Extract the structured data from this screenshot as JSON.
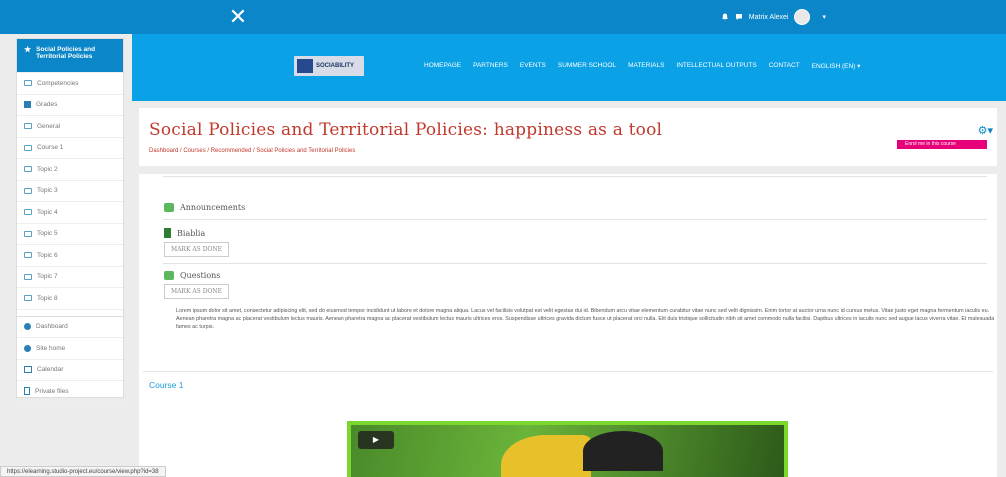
{
  "topbar": {
    "close_glyph": "✕",
    "bell_icon": "bell-icon",
    "chat_icon": "chat-icon",
    "user_name": "Matrix Alexei",
    "caret": "▾"
  },
  "sidebar": {
    "active": {
      "label": "Social Policies and Territorial Policies",
      "icon": "star-icon"
    },
    "items": [
      {
        "label": "Competencies",
        "icon": "checklist-icon"
      },
      {
        "label": "Grades",
        "icon": "table-icon"
      },
      {
        "label": "General",
        "icon": "folder-icon"
      },
      {
        "label": "Course 1",
        "icon": "folder-icon"
      },
      {
        "label": "Topic 2",
        "icon": "folder-icon"
      },
      {
        "label": "Topic 3",
        "icon": "folder-icon"
      },
      {
        "label": "Topic 4",
        "icon": "folder-icon"
      },
      {
        "label": "Topic 5",
        "icon": "folder-icon"
      },
      {
        "label": "Topic 6",
        "icon": "folder-icon"
      },
      {
        "label": "Topic 7",
        "icon": "folder-icon"
      },
      {
        "label": "Topic 8",
        "icon": "folder-icon"
      }
    ],
    "nav": [
      {
        "label": "Dashboard",
        "icon": "dashboard-icon"
      },
      {
        "label": "Site home",
        "icon": "home-icon"
      },
      {
        "label": "Calendar",
        "icon": "calendar-icon"
      },
      {
        "label": "Private files",
        "icon": "file-icon"
      }
    ]
  },
  "header": {
    "logo_text": "SOCIABILITY",
    "nav": [
      "HOMEPAGE",
      "PARTNERS",
      "EVENTS",
      "SUMMER SCHOOL",
      "MATERIALS",
      "INTELLECTUAL OUTPUTS",
      "CONTACT",
      "ENGLISH (EN) ▾"
    ]
  },
  "course": {
    "title": "Social Policies and Territorial Policies: happiness as a tool",
    "breadcrumb": "Dashboard  /  Courses  /  Recommended  /  Social Policies and Territorial Policies",
    "enrol_label": "Enrol me in this course",
    "gear_glyph": "⚙▾"
  },
  "content": {
    "announcements": "Announcements",
    "bibbia": "Biablia",
    "mark_done_1": "MARK AS DONE",
    "questions": "Questions",
    "mark_done_2": "MARK AS DONE",
    "lorem": "Lorem ipsum dolor sit amet, consectetur adipiscing elit, sed do eiusmod tempor incididunt ut labore et dolore magna aliqua. Lacus vel facilisis volutpat est velit egestas dui id. Bibendum arcu vitae elementum curabitur vitae nunc sed velit dignissim. Enim tortor at auctor urna nunc id cursus metus. Vitae justo eget magna fermentum iaculis eu. Aenean pharetra magna ac placerat vestibulum lectus mauris. Aenean pharetra magna ac placerat vestibulum lectus mauris ultrices eros. Suspendisse ultrices gravida dictum fusce ut placerat orci nulla. Elit duis tristique sollicitudin nibh sit amet commodo nulla facilisi. Dapibus ultrices in iaculis nunc sed augue lacus viverra vitae. Et malesuada fames ac turpis.",
    "course1_link": "Course 1",
    "play_glyph": "▶"
  },
  "status": {
    "url": "https://elearning.studio-project.eu/course/view.php?id=38"
  },
  "colors": {
    "brand_blue": "#0b86c8",
    "band_blue": "#0aa1e6",
    "title_red": "#c0392b",
    "enrol_magenta": "#e6007a",
    "video_green": "#7bd62e"
  }
}
